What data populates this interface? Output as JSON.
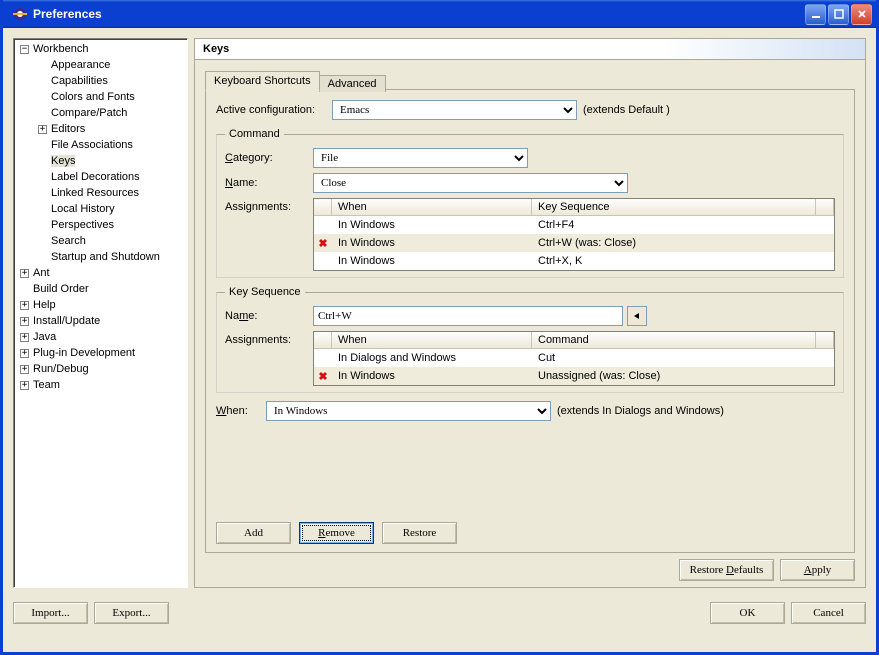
{
  "window": {
    "title": "Preferences"
  },
  "tree": {
    "items": [
      {
        "depth": 1,
        "exp": "minus",
        "label": "Workbench"
      },
      {
        "depth": 2,
        "exp": "none",
        "label": "Appearance"
      },
      {
        "depth": 2,
        "exp": "none",
        "label": "Capabilities"
      },
      {
        "depth": 2,
        "exp": "none",
        "label": "Colors and Fonts"
      },
      {
        "depth": 2,
        "exp": "none",
        "label": "Compare/Patch"
      },
      {
        "depth": 2,
        "exp": "plus",
        "label": "Editors"
      },
      {
        "depth": 2,
        "exp": "none",
        "label": "File Associations"
      },
      {
        "depth": 2,
        "exp": "none",
        "label": "Keys",
        "selected": true
      },
      {
        "depth": 2,
        "exp": "none",
        "label": "Label Decorations"
      },
      {
        "depth": 2,
        "exp": "none",
        "label": "Linked Resources"
      },
      {
        "depth": 2,
        "exp": "none",
        "label": "Local History"
      },
      {
        "depth": 2,
        "exp": "none",
        "label": "Perspectives"
      },
      {
        "depth": 2,
        "exp": "none",
        "label": "Search"
      },
      {
        "depth": 2,
        "exp": "none",
        "label": "Startup and Shutdown"
      },
      {
        "depth": 1,
        "exp": "plus",
        "label": "Ant"
      },
      {
        "depth": 1,
        "exp": "none",
        "label": "Build Order"
      },
      {
        "depth": 1,
        "exp": "plus",
        "label": "Help"
      },
      {
        "depth": 1,
        "exp": "plus",
        "label": "Install/Update"
      },
      {
        "depth": 1,
        "exp": "plus",
        "label": "Java"
      },
      {
        "depth": 1,
        "exp": "plus",
        "label": "Plug-in Development"
      },
      {
        "depth": 1,
        "exp": "plus",
        "label": "Run/Debug"
      },
      {
        "depth": 1,
        "exp": "plus",
        "label": "Team"
      }
    ]
  },
  "page": {
    "title": "Keys",
    "tabs": {
      "active": "Keyboard Shortcuts",
      "inactive": "Advanced"
    },
    "activeConfigLabel": "Active configuration:",
    "activeConfigValue": "Emacs",
    "activeConfigExtends": "(extends Default )",
    "command": {
      "legend": "Command",
      "categoryLabel": "Category:",
      "categoryValue": "File",
      "nameLabel": "Name:",
      "nameValue": "Close",
      "assignmentsLabel": "Assignments:",
      "cols": {
        "icon": "",
        "when": "When",
        "keyseq": "Key Sequence"
      },
      "rows": [
        {
          "icon": "",
          "when": "In Windows",
          "keyseq": "Ctrl+F4"
        },
        {
          "icon": "x",
          "when": "In Windows",
          "keyseq": "Ctrl+W (was: Close)",
          "sel": true
        },
        {
          "icon": "",
          "when": "In Windows",
          "keyseq": "Ctrl+X, K"
        }
      ]
    },
    "keyseq": {
      "legend": "Key Sequence",
      "nameLabel": "Name:",
      "nameValue": "Ctrl+W",
      "assignmentsLabel": "Assignments:",
      "cols": {
        "icon": "",
        "when": "When",
        "command": "Command"
      },
      "rows": [
        {
          "icon": "",
          "when": "In Dialogs and Windows",
          "command": "Cut"
        },
        {
          "icon": "x",
          "when": "In Windows",
          "command": "Unassigned (was: Close)",
          "sel": true
        }
      ]
    },
    "whenLabel": "When:",
    "whenValue": "In Windows",
    "whenExtends": "(extends In Dialogs and Windows)",
    "buttons": {
      "add": "Add",
      "remove": "Remove",
      "restore": "Restore",
      "restoreDefaults": "Restore Defaults",
      "apply": "Apply"
    }
  },
  "footer": {
    "import": "Import...",
    "export": "Export...",
    "ok": "OK",
    "cancel": "Cancel"
  }
}
